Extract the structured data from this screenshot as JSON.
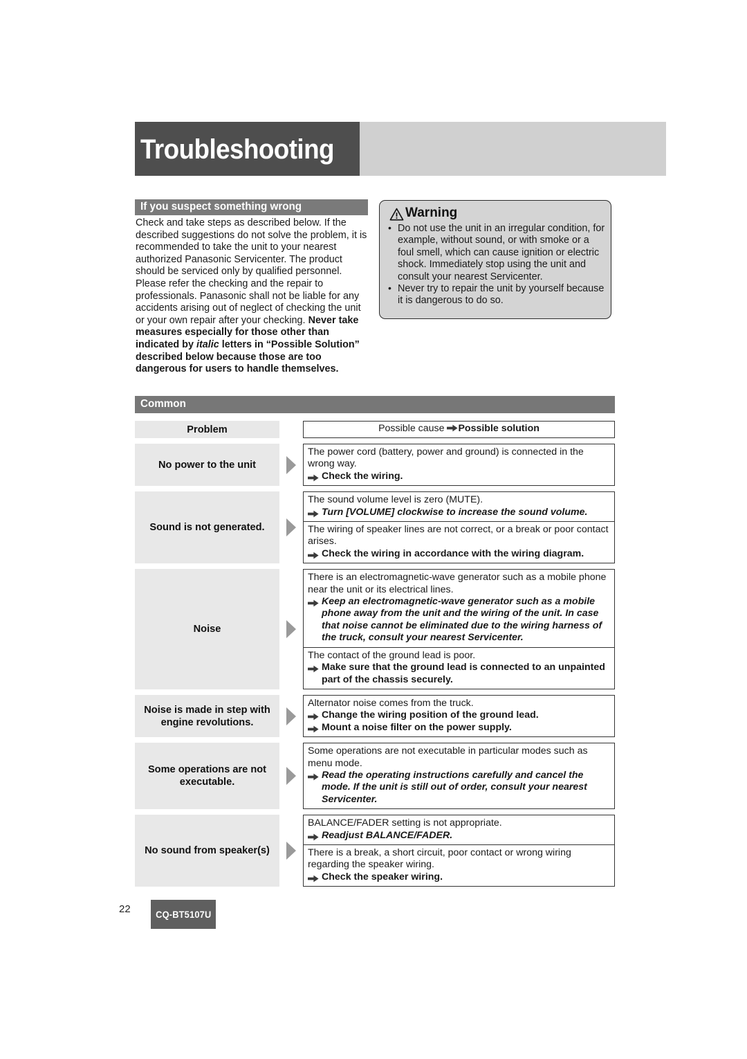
{
  "header": {
    "title": "Troubleshooting"
  },
  "section": {
    "heading": "If you suspect something wrong",
    "paragraph_plain": "Check and take steps as described below. If the described suggestions do not solve the problem, it is recommended to take the unit to your nearest authorized Panasonic Servicenter. The product should be serviced only by qualified personnel. Please refer the checking and the repair to professionals. Panasonic shall not be liable for any accidents arising out of neglect of checking the unit or your own repair after your checking.",
    "paragraph_bold_1": "Never take measures especially for those other than indicated by ",
    "paragraph_bold_italic": "italic",
    "paragraph_bold_2": " letters in “Possible Solution” described below because those are too dangerous for users to handle themselves."
  },
  "warning": {
    "icon": "warning-triangle-icon",
    "title": "Warning",
    "items": [
      "Do not use the unit in an irregular condition, for example, without sound, or with smoke or a foul smell, which can cause ignition or electric shock. Immediately stop using the unit and consult your nearest Servicenter.",
      "Never try to repair the unit by yourself because it is dangerous to do so."
    ]
  },
  "table": {
    "group_label": "Common",
    "header": {
      "problem": "Problem",
      "cause_prefix": "Possible cause ",
      "solution_label": "Possible solution"
    },
    "rows": [
      {
        "problem": "No power to the unit",
        "cells": [
          {
            "cause": "The power cord (battery, power and ground) is connected in the wrong way.",
            "fix": "Check the wiring.",
            "fix_italic": false
          }
        ]
      },
      {
        "problem": "Sound is not generated.",
        "cells": [
          {
            "cause": "The sound volume level is zero (MUTE).",
            "fix": "Turn [VOLUME] clockwise to increase the sound volume.",
            "fix_italic": true
          },
          {
            "cause": "The wiring of speaker lines are not correct, or a break or poor contact arises.",
            "fix": "Check the wiring in accordance with the wiring diagram.",
            "fix_italic": false
          }
        ]
      },
      {
        "problem": "Noise",
        "cells": [
          {
            "cause": "There is an electromagnetic-wave generator such as a mobile phone near the unit or its electrical lines.",
            "fix": "Keep an electromagnetic-wave generator such as a mobile phone away from the unit and the wiring of the unit. In case that noise cannot be eliminated due to the wiring harness of the truck, consult your nearest Servicenter.",
            "fix_italic": true
          },
          {
            "cause": "The contact of the ground lead is poor.",
            "fix": "Make sure that the ground lead is connected to an unpainted part of the chassis securely.",
            "fix_italic": false
          }
        ]
      },
      {
        "problem": "Noise is made in step with engine revolutions.",
        "cells": [
          {
            "cause": "Alternator noise comes from the truck.",
            "fix": "Change the wiring position of the ground lead.",
            "fix_italic": false,
            "fix2": "Mount a noise filter on the power supply.",
            "fix2_italic": false
          }
        ]
      },
      {
        "problem": "Some operations are not executable.",
        "cells": [
          {
            "cause": "Some operations are not executable in particular modes such as menu mode.",
            "fix": "Read the operating instructions carefully and cancel the mode. If the unit is still out of order, consult your nearest Servicenter.",
            "fix_italic": true
          }
        ]
      },
      {
        "problem": "No sound from speaker(s)",
        "cells": [
          {
            "cause": "BALANCE/FADER setting is not appropriate.",
            "fix": "Readjust BALANCE/FADER.",
            "fix_italic": true
          },
          {
            "cause": "There is a break, a short circuit, poor contact or wrong wiring regarding the speaker wiring.",
            "fix": "Check the speaker wiring.",
            "fix_italic": false
          }
        ]
      }
    ]
  },
  "footer": {
    "page_number": "22",
    "model": "CQ-BT5107U"
  },
  "colors": {
    "title_block": "#4e4e4e",
    "title_band": "#d0d0d0",
    "section_head": "#7a7a7a",
    "group_band": "#777777",
    "problem_cell": "#e8e8e8",
    "warning_bg": "#d4d4d4",
    "model_chip": "#5f5f5f"
  }
}
